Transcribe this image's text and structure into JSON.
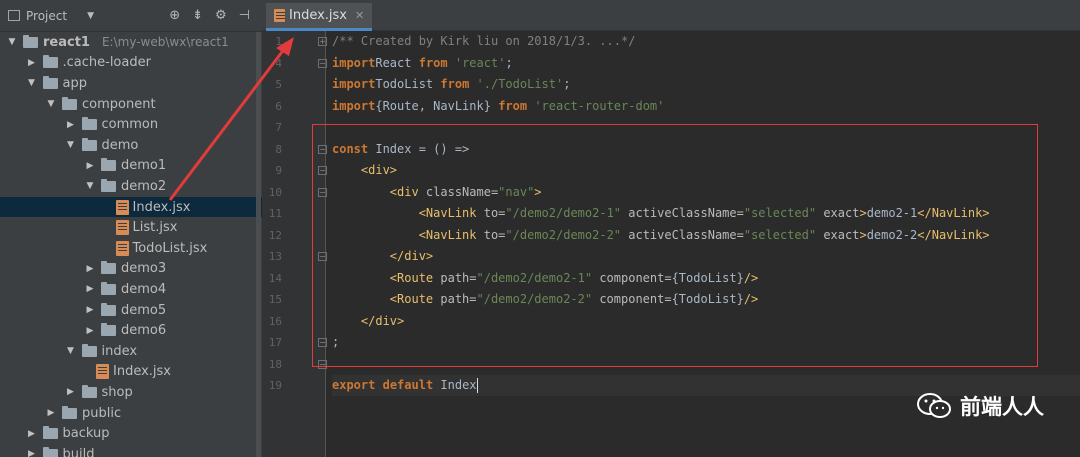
{
  "project_panel": {
    "title": "Project",
    "tree": [
      {
        "label": "react1",
        "path": "E:\\my-web\\wx\\react1",
        "type": "folder",
        "expanded": true,
        "bold": true
      },
      {
        "label": ".cache-loader",
        "type": "folder",
        "expanded": false
      },
      {
        "label": "app",
        "type": "folder",
        "expanded": true
      },
      {
        "label": "component",
        "type": "folder",
        "expanded": true
      },
      {
        "label": "common",
        "type": "folder",
        "expanded": false
      },
      {
        "label": "demo",
        "type": "folder",
        "expanded": true
      },
      {
        "label": "demo1",
        "type": "folder",
        "expanded": false
      },
      {
        "label": "demo2",
        "type": "folder",
        "expanded": true
      },
      {
        "label": "Index.jsx",
        "type": "file",
        "selected": true
      },
      {
        "label": "List.jsx",
        "type": "file"
      },
      {
        "label": "TodoList.jsx",
        "type": "file"
      },
      {
        "label": "demo3",
        "type": "folder",
        "expanded": false
      },
      {
        "label": "demo4",
        "type": "folder",
        "expanded": false
      },
      {
        "label": "demo5",
        "type": "folder",
        "expanded": false
      },
      {
        "label": "demo6",
        "type": "folder",
        "expanded": false
      },
      {
        "label": "index",
        "type": "folder",
        "expanded": true
      },
      {
        "label": "Index.jsx",
        "type": "file"
      },
      {
        "label": "shop",
        "type": "folder",
        "expanded": false
      },
      {
        "label": "public",
        "type": "folder",
        "expanded": false
      },
      {
        "label": "backup",
        "type": "folder",
        "expanded": false
      },
      {
        "label": "build",
        "type": "folder",
        "expanded": false
      }
    ]
  },
  "editor": {
    "tab_label": "Index.jsx",
    "lines": [
      {
        "n": "1",
        "tokens": [
          [
            "cmt",
            "/** Created by Kirk liu on 2018/1/3. ...*/"
          ]
        ]
      },
      {
        "n": "4",
        "tokens": [
          [
            "kw",
            "import"
          ],
          [
            "",
            "React "
          ],
          [
            "kw",
            "from"
          ],
          [
            "",
            " "
          ],
          [
            "str",
            "'react'"
          ],
          [
            "",
            ";"
          ]
        ]
      },
      {
        "n": "5",
        "tokens": [
          [
            "kw",
            "import"
          ],
          [
            "",
            "TodoList "
          ],
          [
            "kw",
            "from"
          ],
          [
            "",
            " "
          ],
          [
            "str",
            "'./TodoList'"
          ],
          [
            "",
            ";"
          ]
        ]
      },
      {
        "n": "6",
        "tokens": [
          [
            "kw",
            "import"
          ],
          [
            "",
            "{Route, NavLink} "
          ],
          [
            "kw",
            "from"
          ],
          [
            "",
            " "
          ],
          [
            "str",
            "'react-router-dom'"
          ]
        ]
      },
      {
        "n": "7",
        "tokens": []
      },
      {
        "n": "8",
        "tokens": [
          [
            "kw",
            "const"
          ],
          [
            "",
            " Index = () =>"
          ]
        ]
      },
      {
        "n": "9",
        "tokens": [
          [
            "",
            "    "
          ],
          [
            "tag",
            "<div>"
          ]
        ]
      },
      {
        "n": "10",
        "tokens": [
          [
            "",
            "        "
          ],
          [
            "tag",
            "<div "
          ],
          [
            "attr",
            "className="
          ],
          [
            "str",
            "\"nav\""
          ],
          [
            "tag",
            ">"
          ]
        ]
      },
      {
        "n": "11",
        "tokens": [
          [
            "",
            "            "
          ],
          [
            "tag",
            "<NavLink "
          ],
          [
            "attr",
            "to="
          ],
          [
            "str",
            "\"/demo2/demo2-1\""
          ],
          [
            "",
            " "
          ],
          [
            "attr",
            "activeClassName="
          ],
          [
            "str",
            "\"selected\""
          ],
          [
            "",
            " "
          ],
          [
            "attr",
            "exact"
          ],
          [
            "tag",
            ">"
          ],
          [
            "",
            "demo2-1"
          ],
          [
            "tag",
            "</NavLink>"
          ]
        ]
      },
      {
        "n": "12",
        "tokens": [
          [
            "",
            "            "
          ],
          [
            "tag",
            "<NavLink "
          ],
          [
            "attr",
            "to="
          ],
          [
            "str",
            "\"/demo2/demo2-2\""
          ],
          [
            "",
            " "
          ],
          [
            "attr",
            "activeClassName="
          ],
          [
            "str",
            "\"selected\""
          ],
          [
            "",
            " "
          ],
          [
            "attr",
            "exact"
          ],
          [
            "tag",
            ">"
          ],
          [
            "",
            "demo2-2"
          ],
          [
            "tag",
            "</NavLink>"
          ]
        ]
      },
      {
        "n": "13",
        "tokens": [
          [
            "",
            "        "
          ],
          [
            "tag",
            "</div>"
          ]
        ]
      },
      {
        "n": "14",
        "tokens": [
          [
            "",
            "        "
          ],
          [
            "tag",
            "<Route "
          ],
          [
            "attr",
            "path="
          ],
          [
            "str",
            "\"/demo2/demo2-1\""
          ],
          [
            "",
            " "
          ],
          [
            "attr",
            "component="
          ],
          [
            "",
            "{TodoList}"
          ],
          [
            "tag",
            "/>"
          ]
        ]
      },
      {
        "n": "15",
        "tokens": [
          [
            "",
            "        "
          ],
          [
            "tag",
            "<Route "
          ],
          [
            "attr",
            "path="
          ],
          [
            "str",
            "\"/demo2/demo2-2\""
          ],
          [
            "",
            " "
          ],
          [
            "attr",
            "component="
          ],
          [
            "",
            "{TodoList}"
          ],
          [
            "tag",
            "/>"
          ]
        ]
      },
      {
        "n": "16",
        "tokens": [
          [
            "",
            "    "
          ],
          [
            "tag",
            "</div>"
          ]
        ]
      },
      {
        "n": "17",
        "tokens": [
          [
            "",
            ";"
          ]
        ]
      },
      {
        "n": "18",
        "tokens": []
      },
      {
        "n": "19",
        "tokens": [
          [
            "kw",
            "export"
          ],
          [
            "",
            " "
          ],
          [
            "kw",
            "default"
          ],
          [
            "",
            " Index"
          ]
        ],
        "current": true
      }
    ]
  },
  "watermark": {
    "text": "前端人人"
  },
  "colors": {
    "highlight_box": "#e33b3b",
    "arrow": "#e33b3b",
    "selection": "#0d293e"
  }
}
